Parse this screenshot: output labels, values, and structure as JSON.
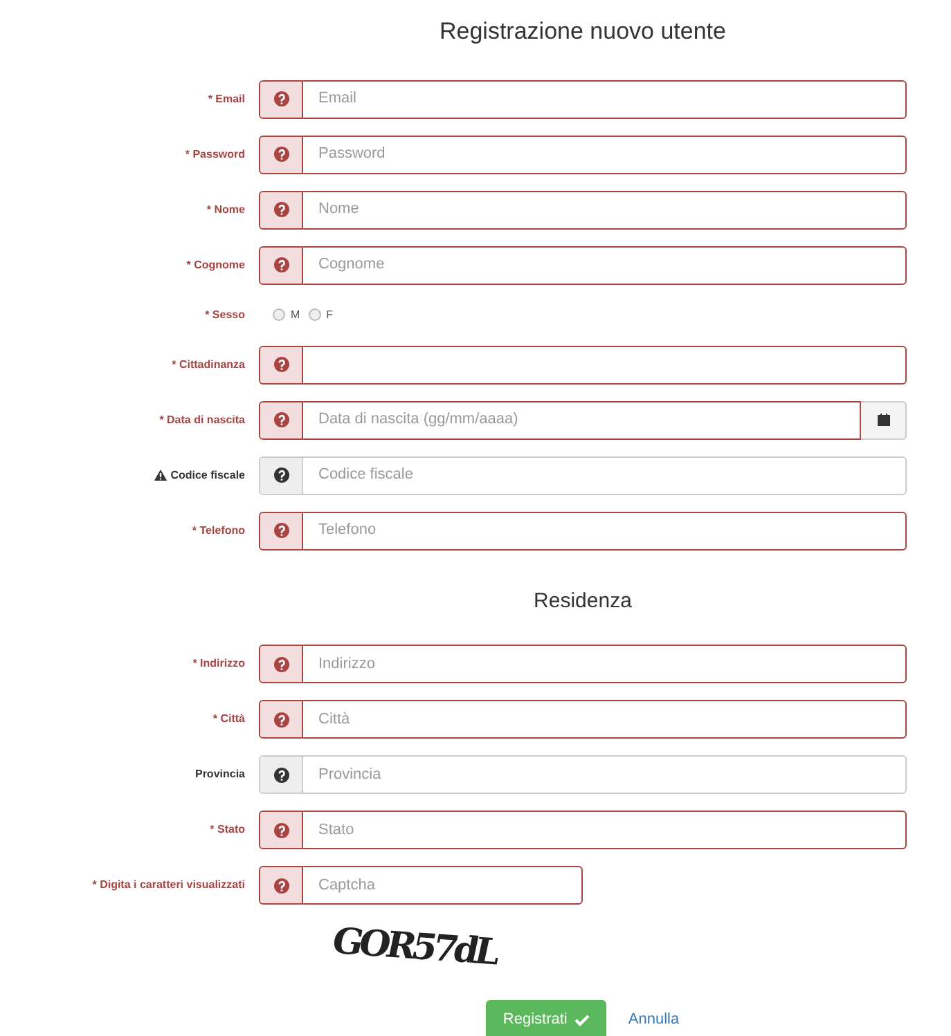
{
  "title": "Registrazione nuovo utente",
  "sections": [
    {
      "fields": [
        {
          "kind": "input",
          "label": "Email",
          "required": true,
          "warning": false,
          "placeholder": "Email"
        },
        {
          "kind": "input",
          "label": "Password",
          "required": true,
          "warning": false,
          "placeholder": "Password"
        },
        {
          "kind": "input",
          "label": "Nome",
          "required": true,
          "warning": false,
          "placeholder": "Nome"
        },
        {
          "kind": "input",
          "label": "Cognome",
          "required": true,
          "warning": false,
          "placeholder": "Cognome"
        },
        {
          "kind": "radio",
          "label": "Sesso",
          "required": true,
          "warning": false,
          "options": [
            {
              "label": "M",
              "selected": false
            },
            {
              "label": "F",
              "selected": false
            }
          ]
        },
        {
          "kind": "input",
          "label": "Cittadinanza",
          "required": true,
          "warning": false
        },
        {
          "kind": "date",
          "label": "Data di nascita",
          "required": true,
          "warning": false,
          "placeholder": "Data di nascita (gg/mm/aaaa)"
        },
        {
          "kind": "input",
          "label": "Codice fiscale",
          "required": false,
          "warning": true,
          "placeholder": "Codice fiscale"
        },
        {
          "kind": "input",
          "label": "Telefono",
          "required": true,
          "warning": false,
          "placeholder": "Telefono"
        }
      ]
    },
    {
      "heading": "Residenza",
      "fields": [
        {
          "kind": "input",
          "label": "Indirizzo",
          "required": true,
          "warning": false,
          "placeholder": "Indirizzo"
        },
        {
          "kind": "input",
          "label": "Città",
          "required": true,
          "warning": false,
          "placeholder": "Città"
        },
        {
          "kind": "input",
          "label": "Provincia",
          "required": false,
          "warning": false,
          "placeholder": "Provincia"
        },
        {
          "kind": "input",
          "label": "Stato",
          "required": true,
          "warning": false,
          "placeholder": "Stato"
        },
        {
          "kind": "captcha",
          "label": "Digita i caratteri visualizzati",
          "required": true,
          "warning": false,
          "placeholder": "Captcha"
        }
      ]
    }
  ],
  "required_mark": "*",
  "captcha_image": "GOR57dL",
  "buttons": {
    "submit": "Registrati",
    "cancel": "Annulla"
  }
}
